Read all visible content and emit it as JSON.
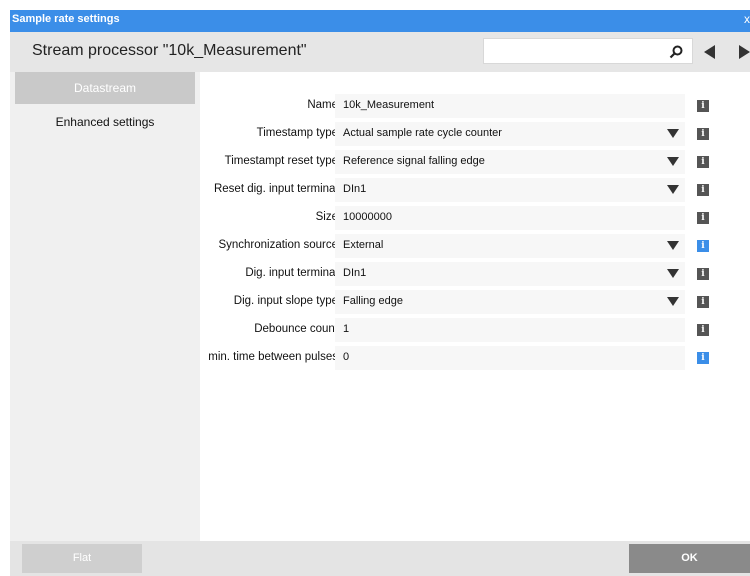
{
  "window": {
    "title": "Sample rate settings",
    "close_glyph": "x"
  },
  "header": {
    "heading": "Stream processor \"10k_Measurement\"",
    "search_value": ""
  },
  "sidebar": {
    "items": [
      {
        "label": "Datastream",
        "active": true
      },
      {
        "label": "Enhanced settings",
        "active": false
      }
    ]
  },
  "fields": [
    {
      "label": "Name",
      "value": "10k_Measurement",
      "dropdown": false,
      "info": "i"
    },
    {
      "label": "Timestamp type",
      "value": "Actual sample rate cycle counter",
      "dropdown": true,
      "info": "i"
    },
    {
      "label": "Timestampt reset type",
      "value": "Reference signal falling edge",
      "dropdown": true,
      "info": "i"
    },
    {
      "label": "Reset dig. input terminal",
      "value": "DIn1",
      "dropdown": true,
      "info": "i"
    },
    {
      "label": "Size",
      "value": "10000000",
      "dropdown": false,
      "info": "i"
    },
    {
      "label": "Synchronization source",
      "value": "External",
      "dropdown": true,
      "info": "i"
    },
    {
      "label": "Dig. input terminal",
      "value": "DIn1",
      "dropdown": true,
      "info": "i"
    },
    {
      "label": "Dig. input slope type",
      "value": "Falling edge",
      "dropdown": true,
      "info": "i"
    },
    {
      "label": "Debounce count",
      "value": "1",
      "dropdown": false,
      "info": "i"
    },
    {
      "label": "min. time between pulses",
      "value": "0",
      "dropdown": false,
      "info": "i"
    }
  ],
  "footer": {
    "flat_label": "Flat",
    "ok_label": "OK"
  },
  "colors": {
    "accent": "#3b8ee8",
    "info_dark": "#555555",
    "info_blue": "#3b8ee8"
  },
  "icons": {
    "search": "search-icon",
    "back": "arrow-left-icon",
    "forward": "arrow-right-icon",
    "dropdown": "triangle-down-icon",
    "info": "info-icon"
  }
}
